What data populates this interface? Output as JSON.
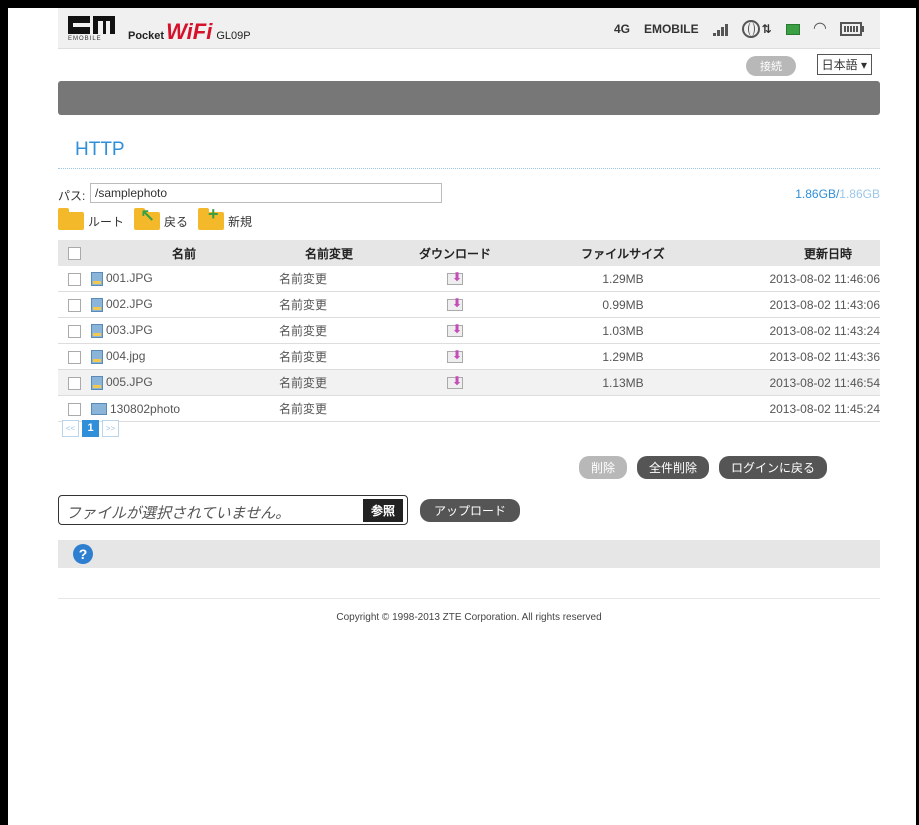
{
  "header": {
    "logo_sub": "EMOBILE",
    "brand_pocket": "Pocket",
    "brand_wifi": "WiFi",
    "model": "GL09P",
    "network_type": "4G",
    "carrier": "EMOBILE"
  },
  "topbar": {
    "connect_label": "接続",
    "language": "日本語 ▾"
  },
  "page_title": "HTTP",
  "path": {
    "label": "パス:",
    "value": "/samplephoto"
  },
  "storage": {
    "used": "1.86GB",
    "separator": "/",
    "total": "1.86GB"
  },
  "nav": {
    "root": "ルート",
    "back": "戻る",
    "new": "新規"
  },
  "table": {
    "headers": {
      "name": "名前",
      "rename": "名前変更",
      "download": "ダウンロード",
      "size": "ファイルサイズ",
      "date": "更新日時"
    },
    "rows": [
      {
        "name": "001.JPG",
        "rename": "名前変更",
        "size": "1.29MB",
        "date": "2013-08-02 11:46:06",
        "type": "file"
      },
      {
        "name": "002.JPG",
        "rename": "名前変更",
        "size": "0.99MB",
        "date": "2013-08-02 11:43:06",
        "type": "file"
      },
      {
        "name": "003.JPG",
        "rename": "名前変更",
        "size": "1.03MB",
        "date": "2013-08-02 11:43:24",
        "type": "file"
      },
      {
        "name": "004.jpg",
        "rename": "名前変更",
        "size": "1.29MB",
        "date": "2013-08-02 11:43:36",
        "type": "file"
      },
      {
        "name": "005.JPG",
        "rename": "名前変更",
        "size": "1.13MB",
        "date": "2013-08-02 11:46:54",
        "type": "file"
      },
      {
        "name": "130802photo",
        "rename": "名前変更",
        "size": "",
        "date": "2013-08-02 11:45:24",
        "type": "folder"
      }
    ]
  },
  "pager": {
    "prev": "<<",
    "current": "1",
    "next": ">>"
  },
  "actions": {
    "delete": "削除",
    "delete_all": "全件削除",
    "back_to_login": "ログインに戻る"
  },
  "upload": {
    "placeholder": "ファイルが選択されていません。",
    "browse": "参照",
    "upload": "アップロード"
  },
  "help": {
    "icon": "?"
  },
  "footer": {
    "copyright": "Copyright © 1998-2013 ZTE Corporation. All rights reserved"
  }
}
